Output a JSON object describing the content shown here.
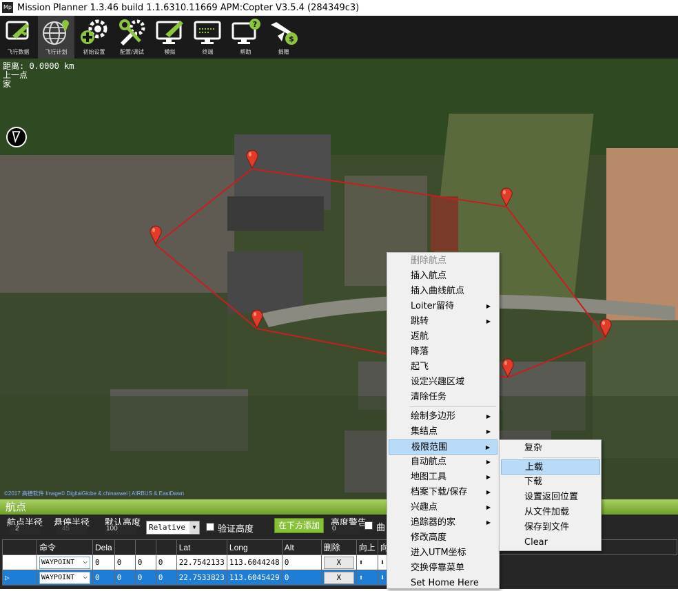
{
  "window": {
    "icon_text": "Mp",
    "title": "Mission Planner 1.3.46 build 1.1.6310.11669 APM:Copter V3.5.4 (284349c3)"
  },
  "toolbar": {
    "items": [
      {
        "label": "飞行数据",
        "icon": "airplane-flight-data-icon"
      },
      {
        "label": "飞行计划",
        "icon": "globe-flight-plan-icon"
      },
      {
        "label": "初始设置",
        "icon": "gear-plus-setup-icon"
      },
      {
        "label": "配置/调试",
        "icon": "wrench-config-icon"
      },
      {
        "label": "模拟",
        "icon": "monitor-plane-sim-icon"
      },
      {
        "label": "终端",
        "icon": "monitor-terminal-icon"
      },
      {
        "label": "帮助",
        "icon": "monitor-help-icon"
      },
      {
        "label": "捐赠",
        "icon": "plane-donate-icon"
      }
    ]
  },
  "map": {
    "distance": "距离: 0.0000 km",
    "prev_point": "上一点",
    "home": "家",
    "attribution": "©2017 高德软件 Image© DigitalGlobe & chinaswei | AIRBUS & EastDawn"
  },
  "waypoints": {
    "header": "航点",
    "wp_radius_label": "航点半径",
    "wp_radius_value": "2",
    "loiter_radius_label": "悬停半径",
    "loiter_radius_value": "45",
    "default_alt_label": "默认高度",
    "default_alt_value": "100",
    "alt_mode": "Relative",
    "verify_height": "验证高度",
    "add_below": "在下方添加",
    "alt_warning_label": "高度警告",
    "alt_warning_value": "0",
    "curve_label": "曲",
    "columns": [
      "命令",
      "Dela",
      "",
      "",
      "",
      "Lat",
      "Long",
      "Alt",
      "删除",
      "向上",
      "向下"
    ],
    "rows": [
      {
        "cmd": "WAYPOINT",
        "p1": "0",
        "p2": "0",
        "p3": "0",
        "p4": "0",
        "lat": "22.7542133",
        "long": "113.6044248",
        "alt": "0",
        "del": "X",
        "selected": false
      },
      {
        "cmd": "WAYPOINT",
        "p1": "0",
        "p2": "0",
        "p3": "0",
        "p4": "0",
        "lat": "22.7533823",
        "long": "113.6045429",
        "alt": "0",
        "del": "X",
        "selected": true
      }
    ]
  },
  "context_menu": {
    "items": [
      {
        "label": "删除航点",
        "disabled": true,
        "submenu": false
      },
      {
        "label": "插入航点",
        "disabled": false,
        "submenu": false
      },
      {
        "label": "插入曲线航点",
        "disabled": false,
        "submenu": false
      },
      {
        "label": "Loiter留待",
        "disabled": false,
        "submenu": true
      },
      {
        "label": "跳转",
        "disabled": false,
        "submenu": true
      },
      {
        "label": "返航",
        "disabled": false,
        "submenu": false
      },
      {
        "label": "降落",
        "disabled": false,
        "submenu": false
      },
      {
        "label": "起飞",
        "disabled": false,
        "submenu": false
      },
      {
        "label": "设定兴趣区域",
        "disabled": false,
        "submenu": false
      },
      {
        "label": "清除任务",
        "disabled": false,
        "submenu": false
      },
      {
        "label": "绘制多边形",
        "disabled": false,
        "submenu": true
      },
      {
        "label": "集结点",
        "disabled": false,
        "submenu": true
      },
      {
        "label": "极限范围",
        "disabled": false,
        "submenu": true,
        "highlighted": true
      },
      {
        "label": "自动航点",
        "disabled": false,
        "submenu": true
      },
      {
        "label": "地图工具",
        "disabled": false,
        "submenu": true
      },
      {
        "label": "档案下载/保存",
        "disabled": false,
        "submenu": true
      },
      {
        "label": "兴趣点",
        "disabled": false,
        "submenu": true
      },
      {
        "label": "追踪器的家",
        "disabled": false,
        "submenu": true
      },
      {
        "label": "修改高度",
        "disabled": false,
        "submenu": false
      },
      {
        "label": "进入UTM坐标",
        "disabled": false,
        "submenu": false
      },
      {
        "label": "交换停靠菜单",
        "disabled": false,
        "submenu": false
      },
      {
        "label": "Set Home Here",
        "disabled": false,
        "submenu": false
      }
    ]
  },
  "fence_submenu": {
    "items": [
      {
        "label": "复杂",
        "highlighted": false
      },
      {
        "label": "上载",
        "highlighted": true
      },
      {
        "label": "下载",
        "highlighted": false
      },
      {
        "label": "设置返回位置",
        "highlighted": false
      },
      {
        "label": "从文件加载",
        "highlighted": false
      },
      {
        "label": "保存到文件",
        "highlighted": false
      },
      {
        "label": "Clear",
        "highlighted": false
      }
    ]
  },
  "colors": {
    "route_line": "#c81e1e",
    "marker": "#e23b2b",
    "panel_header": "#8ab842",
    "selection": "#1e7ed6",
    "menu_highlight": "#b9dbf7"
  }
}
